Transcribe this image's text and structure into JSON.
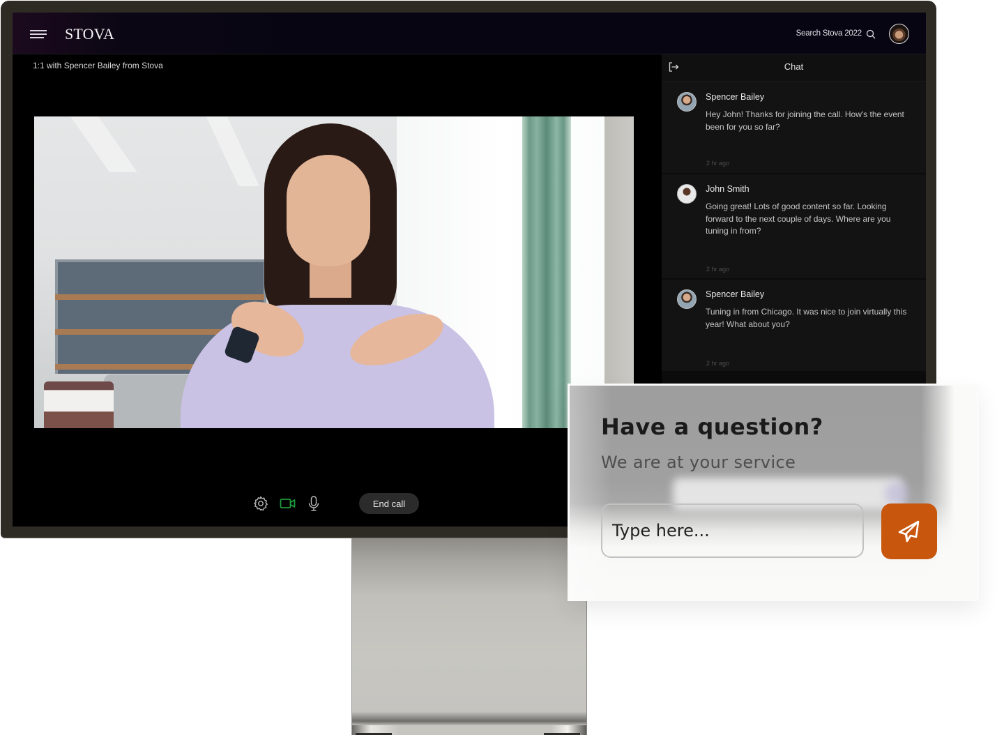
{
  "app": {
    "brand": "STOVA",
    "search_label": "Search Stova 2022",
    "session_title": "1:1 with Spencer Bailey from Stova"
  },
  "call_controls": {
    "settings_icon": "gear-icon",
    "video_icon": "video-camera-icon",
    "mic_icon": "microphone-icon",
    "end_call_label": "End call",
    "video_active_color": "#1e9a3c"
  },
  "chat": {
    "title": "Chat",
    "exit_icon": "exit-icon",
    "messages": [
      {
        "author": "Spencer Bailey",
        "text": "Hey John! Thanks for joining the call. How's the event been for you so far?",
        "time": "2 hr ago"
      },
      {
        "author": "John Smith",
        "text": "Going great! Lots of good content so far. Looking forward to the next couple of days. Where are you tuning in from?",
        "time": "2 hr ago"
      },
      {
        "author": "Spencer Bailey",
        "text": "Tuning in from Chicago. It was nice to join virtually this year! What about you?",
        "time": "2 hr ago"
      }
    ]
  },
  "question_card": {
    "title": "Have a question?",
    "subtitle": "We are at your service",
    "input_placeholder": "Type here...",
    "send_icon": "paper-plane-icon",
    "accent_color": "#c8560d"
  }
}
